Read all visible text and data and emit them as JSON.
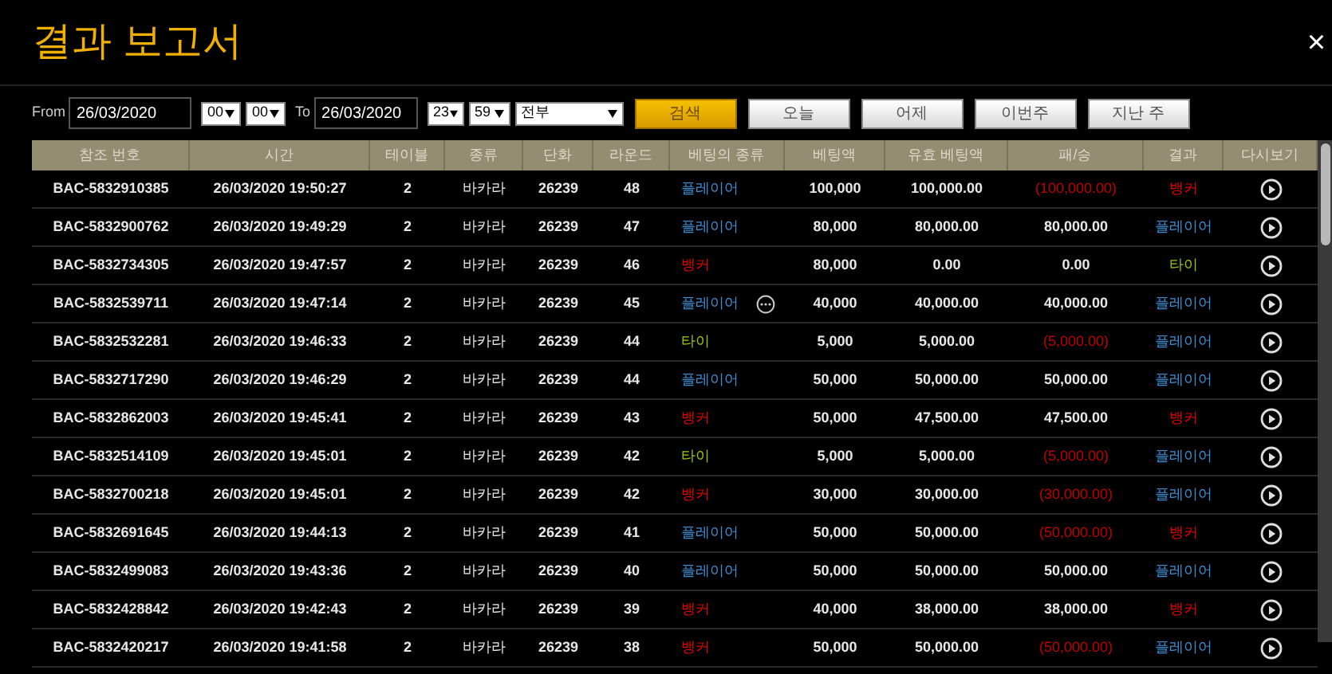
{
  "window": {
    "title": "결과 보고서",
    "close": "×"
  },
  "filters": {
    "from_label": "From",
    "from_date": "26/03/2020",
    "from_hour": "00",
    "from_minute": "00",
    "to_label": "To",
    "to_date": "26/03/2020",
    "to_hour": "23",
    "to_minute": "59",
    "bet_type": "전부",
    "search_button": "검색",
    "quick_buttons": [
      "오늘",
      "어제",
      "이번주",
      "지난 주"
    ]
  },
  "table": {
    "columns": [
      "참조 번호",
      "시간",
      "테이블",
      "종류",
      "단화",
      "라운드",
      "베팅의 종류",
      "베팅액",
      "유효 베팅액",
      "패/승",
      "결과",
      "다시보기"
    ],
    "rows": [
      {
        "ref": "BAC-5832910385",
        "time": "26/03/2020 19:50:27",
        "table": "2",
        "game": "바카라",
        "shoe": "26239",
        "round": "48",
        "bet": {
          "text": "플레이어",
          "color": "#3d8fd6"
        },
        "more": false,
        "amount": "100,000",
        "valid": "100,000.00",
        "win_loss": "(100,000.00)",
        "loss": true,
        "result": {
          "text": "뱅커",
          "color": "#e00000"
        }
      },
      {
        "ref": "BAC-5832900762",
        "time": "26/03/2020 19:49:29",
        "table": "2",
        "game": "바카라",
        "shoe": "26239",
        "round": "47",
        "bet": {
          "text": "플레이어",
          "color": "#3d8fd6"
        },
        "more": false,
        "amount": "80,000",
        "valid": "80,000.00",
        "win_loss": "80,000.00",
        "loss": false,
        "result": {
          "text": "플레이어",
          "color": "#3d8fd6"
        }
      },
      {
        "ref": "BAC-5832734305",
        "time": "26/03/2020 19:47:57",
        "table": "2",
        "game": "바카라",
        "shoe": "26239",
        "round": "46",
        "bet": {
          "text": "뱅커",
          "color": "#e00000"
        },
        "more": false,
        "amount": "80,000",
        "valid": "0.00",
        "win_loss": "0.00",
        "loss": false,
        "result": {
          "text": "타이",
          "color": "#a4c400"
        }
      },
      {
        "ref": "BAC-5832539711",
        "time": "26/03/2020 19:47:14",
        "table": "2",
        "game": "바카라",
        "shoe": "26239",
        "round": "45",
        "bet": {
          "text": "플레이어",
          "color": "#3d8fd6"
        },
        "more": true,
        "amount": "40,000",
        "valid": "40,000.00",
        "win_loss": "40,000.00",
        "loss": false,
        "result": {
          "text": "플레이어",
          "color": "#3d8fd6"
        }
      },
      {
        "ref": "BAC-5832532281",
        "time": "26/03/2020 19:46:33",
        "table": "2",
        "game": "바카라",
        "shoe": "26239",
        "round": "44",
        "bet": {
          "text": "타이",
          "color": "#a4c400"
        },
        "more": false,
        "amount": "5,000",
        "valid": "5,000.00",
        "win_loss": "(5,000.00)",
        "loss": true,
        "result": {
          "text": "플레이어",
          "color": "#3d8fd6"
        }
      },
      {
        "ref": "BAC-5832717290",
        "time": "26/03/2020 19:46:29",
        "table": "2",
        "game": "바카라",
        "shoe": "26239",
        "round": "44",
        "bet": {
          "text": "플레이어",
          "color": "#3d8fd6"
        },
        "more": false,
        "amount": "50,000",
        "valid": "50,000.00",
        "win_loss": "50,000.00",
        "loss": false,
        "result": {
          "text": "플레이어",
          "color": "#3d8fd6"
        }
      },
      {
        "ref": "BAC-5832862003",
        "time": "26/03/2020 19:45:41",
        "table": "2",
        "game": "바카라",
        "shoe": "26239",
        "round": "43",
        "bet": {
          "text": "뱅커",
          "color": "#e00000"
        },
        "more": false,
        "amount": "50,000",
        "valid": "47,500.00",
        "win_loss": "47,500.00",
        "loss": false,
        "result": {
          "text": "뱅커",
          "color": "#e00000"
        }
      },
      {
        "ref": "BAC-5832514109",
        "time": "26/03/2020 19:45:01",
        "table": "2",
        "game": "바카라",
        "shoe": "26239",
        "round": "42",
        "bet": {
          "text": "타이",
          "color": "#a4c400"
        },
        "more": false,
        "amount": "5,000",
        "valid": "5,000.00",
        "win_loss": "(5,000.00)",
        "loss": true,
        "result": {
          "text": "플레이어",
          "color": "#3d8fd6"
        }
      },
      {
        "ref": "BAC-5832700218",
        "time": "26/03/2020 19:45:01",
        "table": "2",
        "game": "바카라",
        "shoe": "26239",
        "round": "42",
        "bet": {
          "text": "뱅커",
          "color": "#e00000"
        },
        "more": false,
        "amount": "30,000",
        "valid": "30,000.00",
        "win_loss": "(30,000.00)",
        "loss": true,
        "result": {
          "text": "플레이어",
          "color": "#3d8fd6"
        }
      },
      {
        "ref": "BAC-5832691645",
        "time": "26/03/2020 19:44:13",
        "table": "2",
        "game": "바카라",
        "shoe": "26239",
        "round": "41",
        "bet": {
          "text": "플레이어",
          "color": "#3d8fd6"
        },
        "more": false,
        "amount": "50,000",
        "valid": "50,000.00",
        "win_loss": "(50,000.00)",
        "loss": true,
        "result": {
          "text": "뱅커",
          "color": "#e00000"
        }
      },
      {
        "ref": "BAC-5832499083",
        "time": "26/03/2020 19:43:36",
        "table": "2",
        "game": "바카라",
        "shoe": "26239",
        "round": "40",
        "bet": {
          "text": "플레이어",
          "color": "#3d8fd6"
        },
        "more": false,
        "amount": "50,000",
        "valid": "50,000.00",
        "win_loss": "50,000.00",
        "loss": false,
        "result": {
          "text": "플레이어",
          "color": "#3d8fd6"
        }
      },
      {
        "ref": "BAC-5832428842",
        "time": "26/03/2020 19:42:43",
        "table": "2",
        "game": "바카라",
        "shoe": "26239",
        "round": "39",
        "bet": {
          "text": "뱅커",
          "color": "#e00000"
        },
        "more": false,
        "amount": "40,000",
        "valid": "38,000.00",
        "win_loss": "38,000.00",
        "loss": false,
        "result": {
          "text": "뱅커",
          "color": "#e00000"
        }
      },
      {
        "ref": "BAC-5832420217",
        "time": "26/03/2020 19:41:58",
        "table": "2",
        "game": "바카라",
        "shoe": "26239",
        "round": "38",
        "bet": {
          "text": "뱅커",
          "color": "#e00000"
        },
        "more": false,
        "amount": "50,000",
        "valid": "50,000.00",
        "win_loss": "(50,000.00)",
        "loss": true,
        "result": {
          "text": "플레이어",
          "color": "#3d8fd6"
        }
      }
    ]
  }
}
